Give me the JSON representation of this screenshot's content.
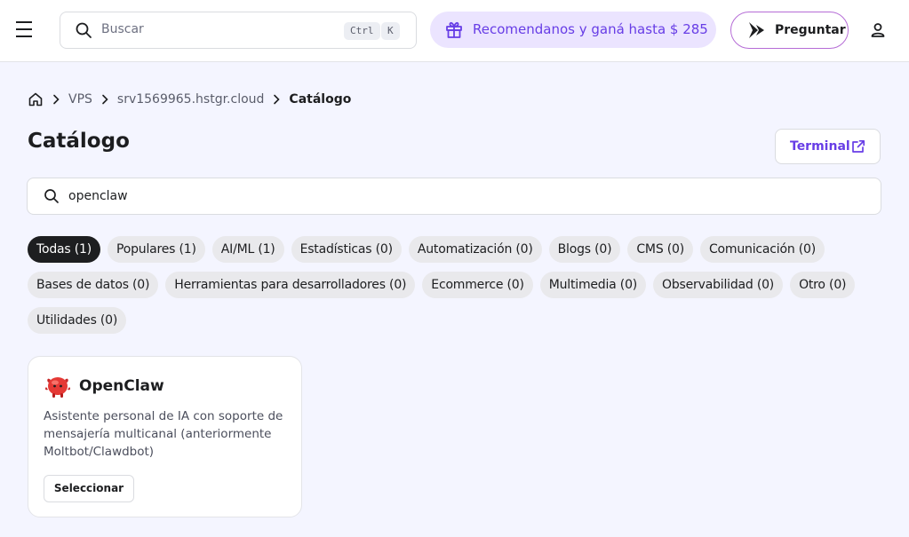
{
  "header": {
    "search_placeholder": "Buscar",
    "shortcut_ctrl": "Ctrl",
    "shortcut_key": "K",
    "promo_text": "Recomendanos y ganá hasta $ 285",
    "ask_label": "Preguntar"
  },
  "breadcrumb": {
    "items": [
      "VPS",
      "srv1569965.hstgr.cloud"
    ],
    "current": "Catálogo"
  },
  "page": {
    "title": "Catálogo",
    "terminal_label": "Terminal",
    "filter_value": "openclaw"
  },
  "categories": [
    "Todas (1)",
    "Populares (1)",
    "AI/ML (1)",
    "Estadísticas (0)",
    "Automatización (0)",
    "Blogs (0)",
    "CMS (0)",
    "Comunicación (0)",
    "Bases de datos (0)",
    "Herramientas para desarrolladores (0)",
    "Ecommerce (0)",
    "Multimedia (0)",
    "Observabilidad (0)",
    "Otro (0)",
    "Utilidades (0)"
  ],
  "active_category": "Todas (1)",
  "apps": [
    {
      "name": "OpenClaw",
      "description": "Asistente personal de IA con soporte de mensajería multicanal (anteriormente Moltbot/Clawdbot)",
      "button_label": "Seleccionar",
      "icon": "red-claw-mascot-icon"
    }
  ],
  "colors": {
    "accent": "#673de6",
    "promo_bg": "#ebe4ff",
    "page_bg": "#f4f5ff",
    "chip_active": "#1d1e20",
    "chip_bg": "#e9e9ec"
  }
}
